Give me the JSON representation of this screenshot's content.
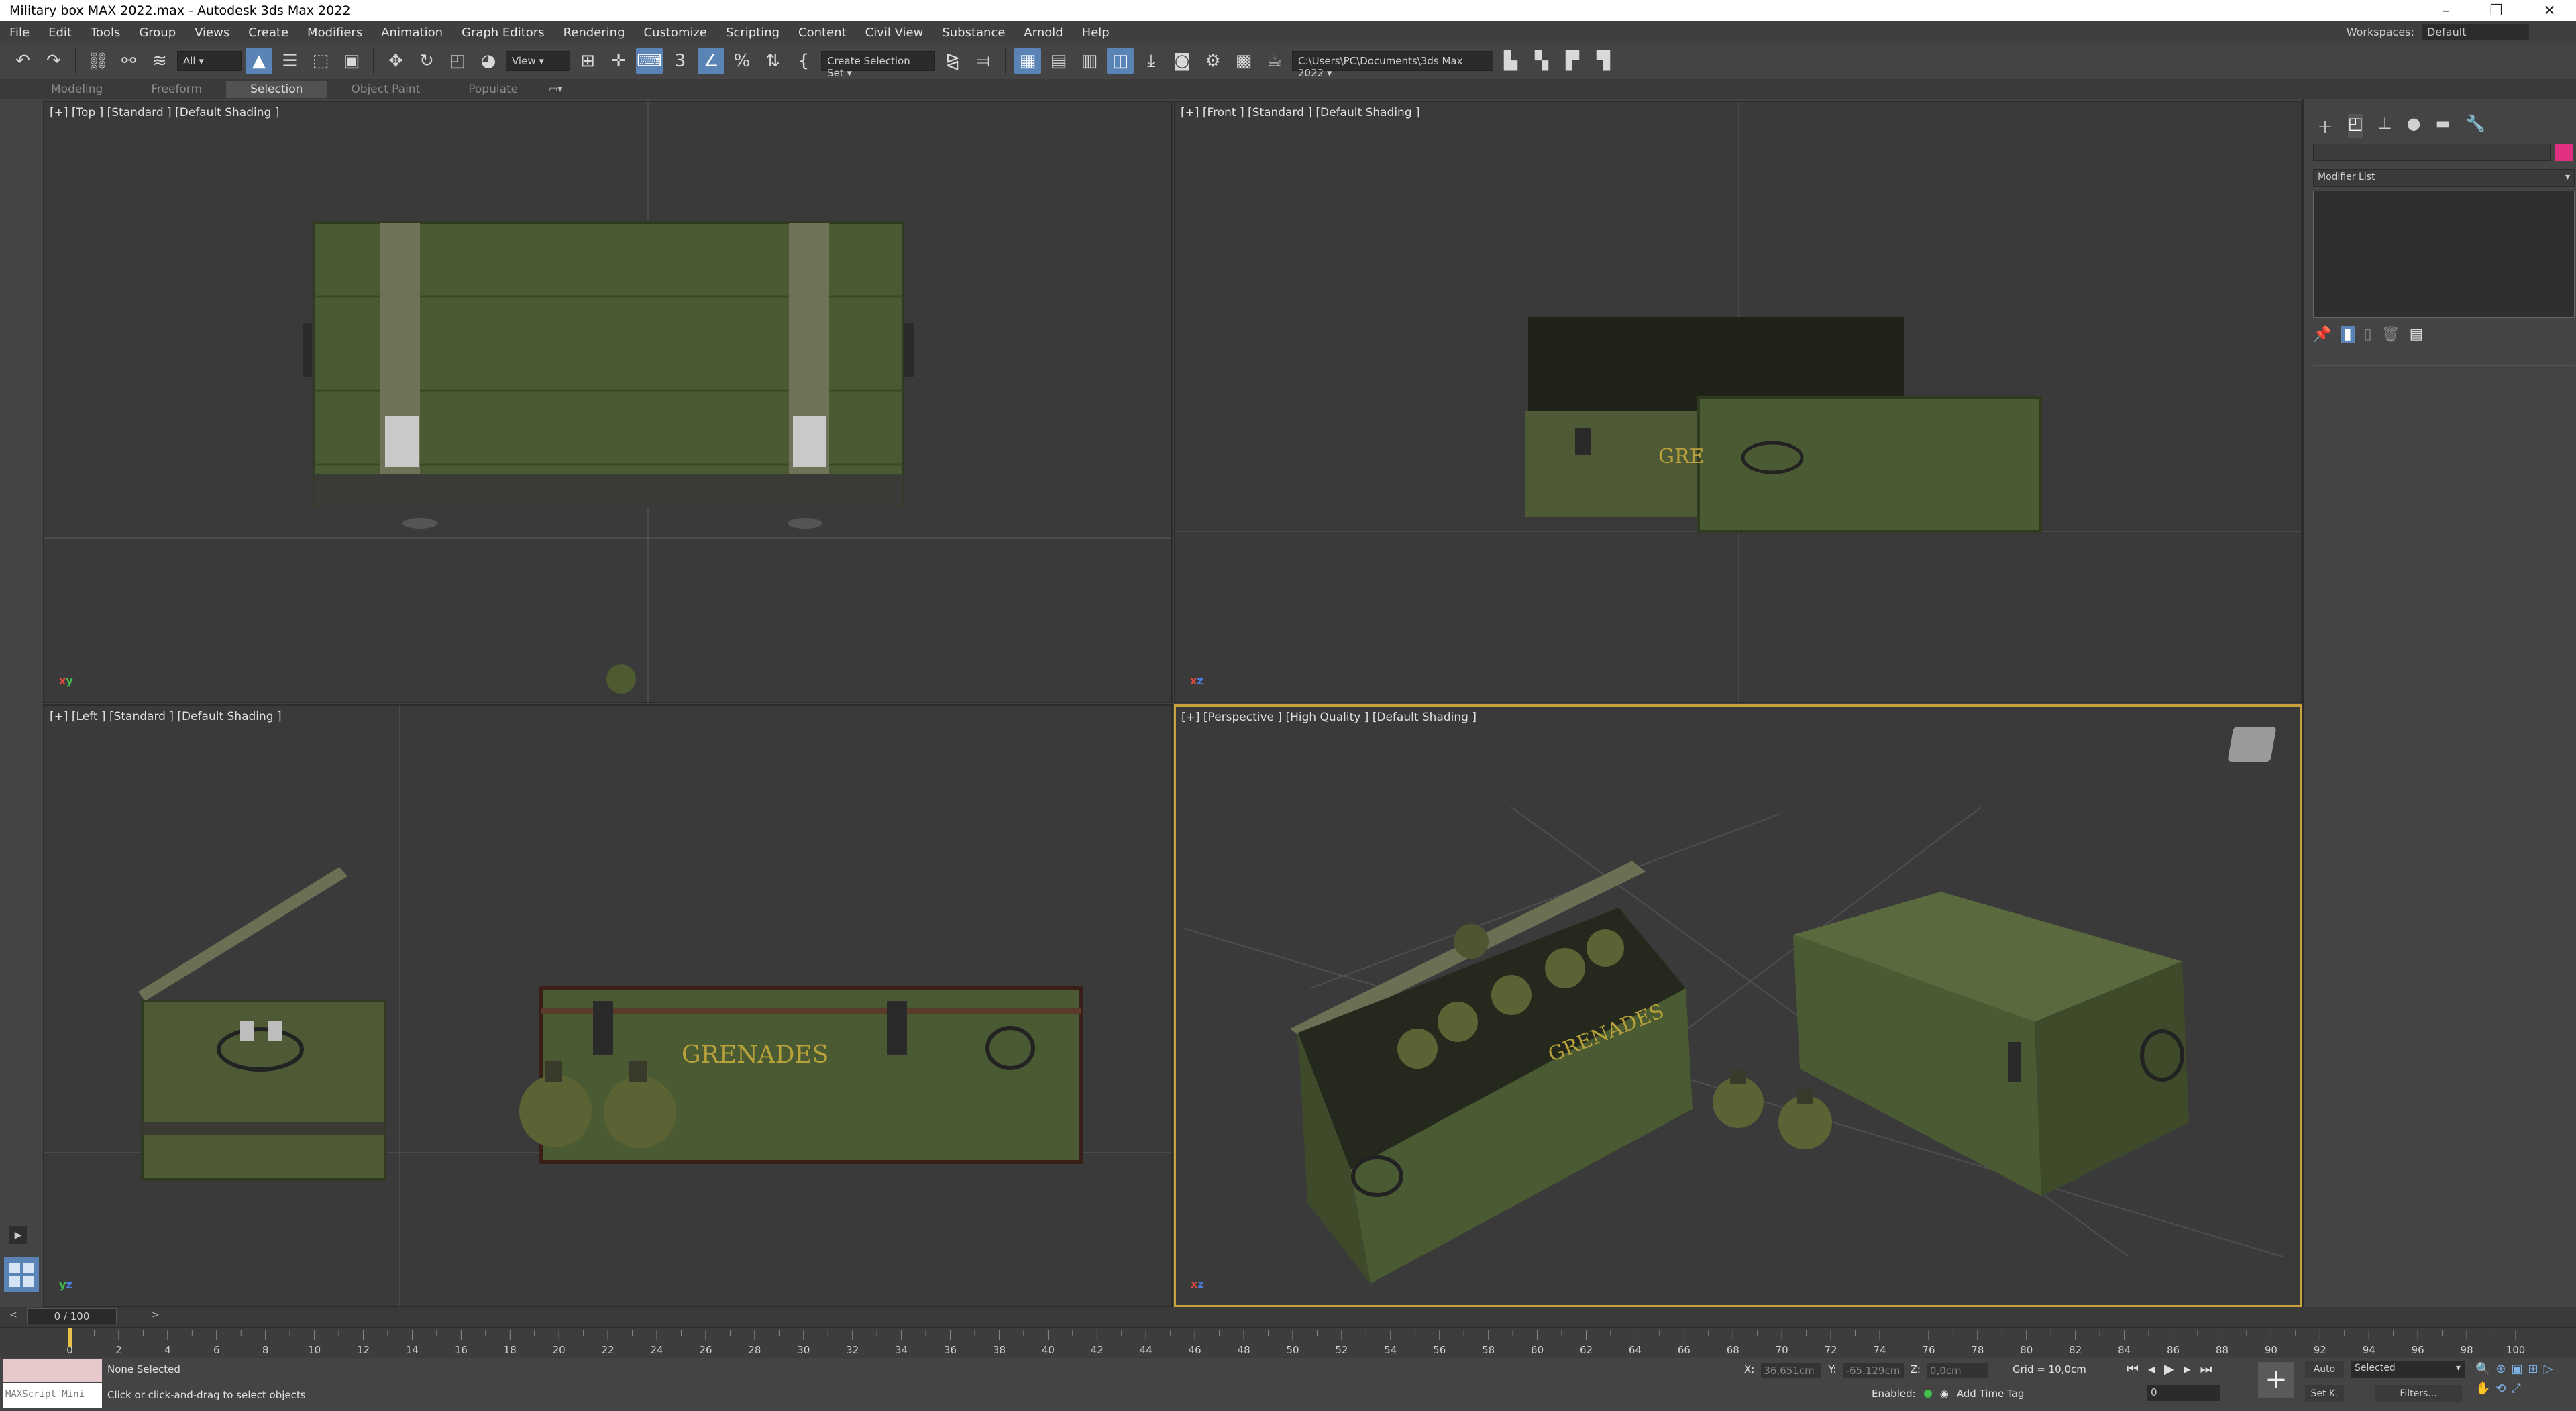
{
  "window": {
    "title": "Military box MAX 2022.max - Autodesk 3ds Max 2022",
    "controls": [
      "–",
      "❐",
      "✕"
    ]
  },
  "menu": {
    "items": [
      "File",
      "Edit",
      "Tools",
      "Group",
      "Views",
      "Create",
      "Modifiers",
      "Animation",
      "Graph Editors",
      "Rendering",
      "Customize",
      "Scripting",
      "Content",
      "Civil View",
      "Substance",
      "Arnold",
      "Help"
    ],
    "workspaces_label": "Workspaces:",
    "workspaces_value": "Default"
  },
  "toolbar": {
    "filter_value": "All",
    "refcoord_value": "View",
    "selection_set_placeholder": "Create Selection Set",
    "project_path": "C:\\Users\\PC\\Documents\\3ds Max 2022"
  },
  "ribbon": {
    "tabs": [
      "Modeling",
      "Freeform",
      "Selection",
      "Object Paint",
      "Populate"
    ],
    "active": "Selection"
  },
  "viewports": {
    "top": "[+] [Top ] [Standard ] [Default Shading ]",
    "front": "[+] [Front ] [Standard ] [Default Shading ]",
    "left": "[+] [Left ] [Standard ] [Default Shading ]",
    "perspective": "[+] [Perspective ] [High Quality ] [Default Shading ]",
    "crate_text": "GRENADES",
    "crate_text_short": "GRE",
    "axis_x": "x",
    "axis_y": "y",
    "axis_z": "z"
  },
  "command_panel": {
    "modifier_list": "Modifier List",
    "object_color": "#e0307f"
  },
  "timeline": {
    "frame_display": "0 / 100",
    "ticks": [
      0,
      2,
      4,
      6,
      8,
      10,
      12,
      14,
      16,
      18,
      20,
      22,
      24,
      26,
      28,
      30,
      32,
      34,
      36,
      38,
      40,
      42,
      44,
      46,
      48,
      50,
      52,
      54,
      56,
      58,
      60,
      62,
      64,
      66,
      68,
      70,
      72,
      74,
      76,
      78,
      80,
      82,
      84,
      86,
      88,
      90,
      92,
      94,
      96,
      98,
      100
    ],
    "current_frame": 0
  },
  "status": {
    "maxscript_placeholder": "MAXScript Mini",
    "selection": "None Selected",
    "prompt": "Click or click-and-drag to select objects",
    "x_label": "X:",
    "x_value": "36,651cm",
    "y_label": "Y:",
    "y_value": "-65,129cm",
    "z_label": "Z:",
    "z_value": "0,0cm",
    "grid": "Grid = 10,0cm",
    "enabled_label": "Enabled:",
    "add_time_tag": "Add Time Tag",
    "frame_field": "0",
    "auto": "Auto",
    "set_key": "Set K.",
    "key_filter": "Selected",
    "filters": "Filters..."
  },
  "colors": {
    "accent": "#5a84b5",
    "active_viewport_border": "#c8a03c",
    "crate_green": "#4a5a32",
    "stencil_yellow": "#b9a23a"
  }
}
